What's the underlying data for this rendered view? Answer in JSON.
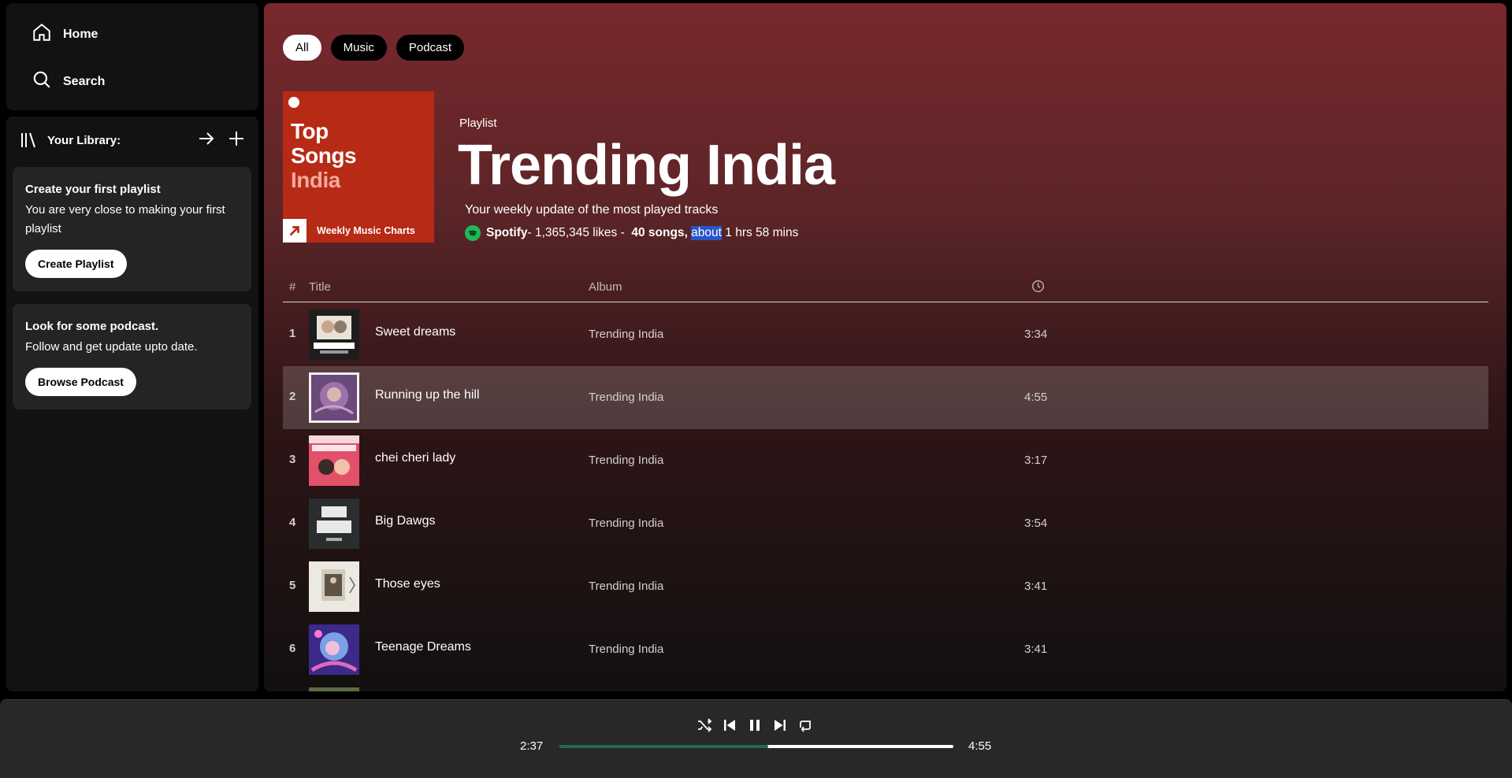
{
  "nav": {
    "home_label": "Home",
    "search_label": "Search"
  },
  "library": {
    "title": "Your Library:",
    "cards": [
      {
        "heading": "Create your first playlist",
        "text": "You are very close to making your first playlist",
        "button": "Create Playlist"
      },
      {
        "heading": "Look for some podcast.",
        "text": "Follow and get update upto date.",
        "button": "Browse Podcast"
      }
    ]
  },
  "filters": [
    "All",
    "Music",
    "Podcast"
  ],
  "cover": {
    "line1": "Top",
    "line2": "Songs",
    "line3": "India",
    "footer": "Weekly Music Charts"
  },
  "playlist": {
    "type": "Playlist",
    "title": "Trending India",
    "description": "Your weekly update of the most played tracks",
    "owner": "Spotify",
    "likes": "- 1,365,345 likes - ",
    "songs": "40 songs,",
    "about": "about",
    "duration": " 1 hrs 58 mins"
  },
  "table": {
    "headers": {
      "num": "#",
      "title": "Title",
      "album": "Album"
    },
    "rows": [
      {
        "num": "1",
        "title": "Sweet dreams",
        "album": "Trending India",
        "duration": "3:34"
      },
      {
        "num": "2",
        "title": "Running up the hill",
        "album": "Trending India",
        "duration": "4:55"
      },
      {
        "num": "3",
        "title": "chei cheri lady",
        "album": "Trending India",
        "duration": "3:17"
      },
      {
        "num": "4",
        "title": "Big Dawgs",
        "album": "Trending India",
        "duration": "3:54"
      },
      {
        "num": "5",
        "title": "Those eyes",
        "album": "Trending India",
        "duration": "3:41"
      },
      {
        "num": "6",
        "title": "Teenage Dreams",
        "album": "Trending India",
        "duration": "3:41"
      }
    ]
  },
  "player": {
    "current_time": "2:37",
    "total_time": "4:55",
    "progress": 0.53
  },
  "colors": {
    "accent": "#1db954",
    "cover": "#b72a16",
    "highlight": "#2953c8"
  }
}
